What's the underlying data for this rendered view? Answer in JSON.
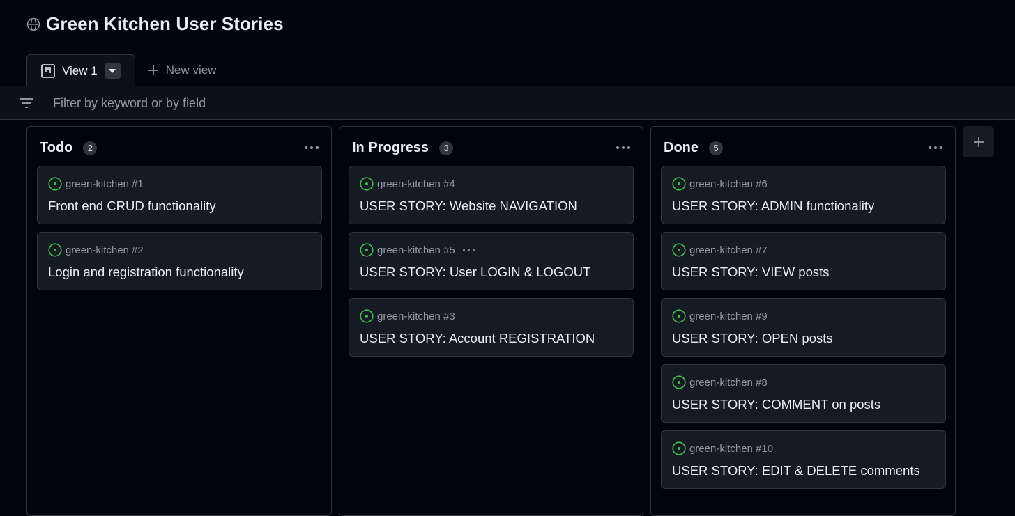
{
  "project": {
    "title": "Green Kitchen User Stories"
  },
  "tabs": [
    {
      "label": "View 1"
    }
  ],
  "new_view_label": "New view",
  "filter": {
    "placeholder": "Filter by keyword or by field"
  },
  "colors": {
    "background": "#010409",
    "card": "#151b23",
    "border": "#30363d",
    "open_issue": "#3fb950",
    "muted_text": "#9198a1"
  },
  "columns": [
    {
      "title": "Todo",
      "count": "2",
      "cards": [
        {
          "repo": "green-kitchen #1",
          "title": "Front end CRUD functionality"
        },
        {
          "repo": "green-kitchen #2",
          "title": "Login and registration functionality"
        }
      ]
    },
    {
      "title": "In Progress",
      "count": "3",
      "cards": [
        {
          "repo": "green-kitchen #4",
          "title": "USER STORY: Website NAVIGATION"
        },
        {
          "repo": "green-kitchen #5",
          "title": "USER STORY: User LOGIN & LOGOUT"
        },
        {
          "repo": "green-kitchen #3",
          "title": "USER STORY: Account REGISTRATION"
        }
      ]
    },
    {
      "title": "Done",
      "count": "5",
      "cards": [
        {
          "repo": "green-kitchen #6",
          "title": "USER STORY: ADMIN functionality"
        },
        {
          "repo": "green-kitchen #7",
          "title": "USER STORY: VIEW posts"
        },
        {
          "repo": "green-kitchen #9",
          "title": "USER STORY: OPEN posts"
        },
        {
          "repo": "green-kitchen #8",
          "title": "USER STORY: COMMENT on posts"
        },
        {
          "repo": "green-kitchen #10",
          "title": "USER STORY: EDIT & DELETE comments"
        }
      ]
    }
  ]
}
